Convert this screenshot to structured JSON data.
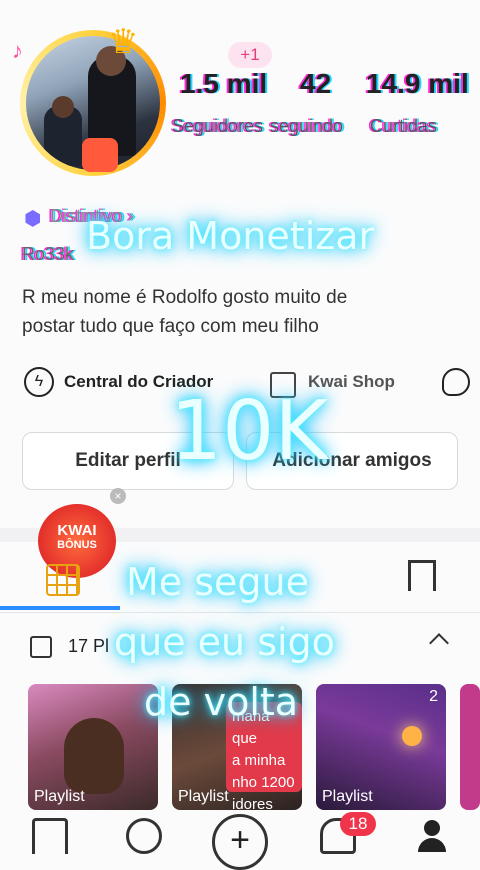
{
  "profile": {
    "stats": [
      {
        "value": "1.5 mil",
        "label": "Seguidores"
      },
      {
        "value": "42",
        "label": "seguindo"
      },
      {
        "value": "14.9 mil",
        "label": "Curtidas"
      }
    ],
    "plus_badge": "+1",
    "distintivo": "Distintivo ›",
    "username_partial": "Ro33k",
    "bio": "R meu nome é Rodolfo gosto muito de postar tudo que faço com meu filho"
  },
  "links": {
    "creator_center": "Central do Criador",
    "shop": "Kwai Shop"
  },
  "buttons": {
    "edit_profile": "Editar perfil",
    "add_friends": "Adicionar amigos"
  },
  "bonus": {
    "line1": "KWAI",
    "line2": "BÔNUS"
  },
  "playlist_header": {
    "text": "17 Pl"
  },
  "thumbnails": [
    {
      "label": "Playlist",
      "count": ""
    },
    {
      "label": "Playlist",
      "count": "",
      "caption_lines": [
        "mana que",
        "a minha",
        "nho 1200",
        "idores"
      ]
    },
    {
      "label": "Playlist",
      "count": "2"
    }
  ],
  "overlay": {
    "line1": "Bora Monetizar",
    "line2": "10K",
    "line3a": "Me segue",
    "line3b": "que eu sigo",
    "line3c": "de volta"
  },
  "nav": {
    "notifications_badge": "18"
  },
  "colors": {
    "accent_blue": "#2b8cff",
    "badge_red": "#f0344a",
    "neon_cyan": "#4df2ff"
  }
}
